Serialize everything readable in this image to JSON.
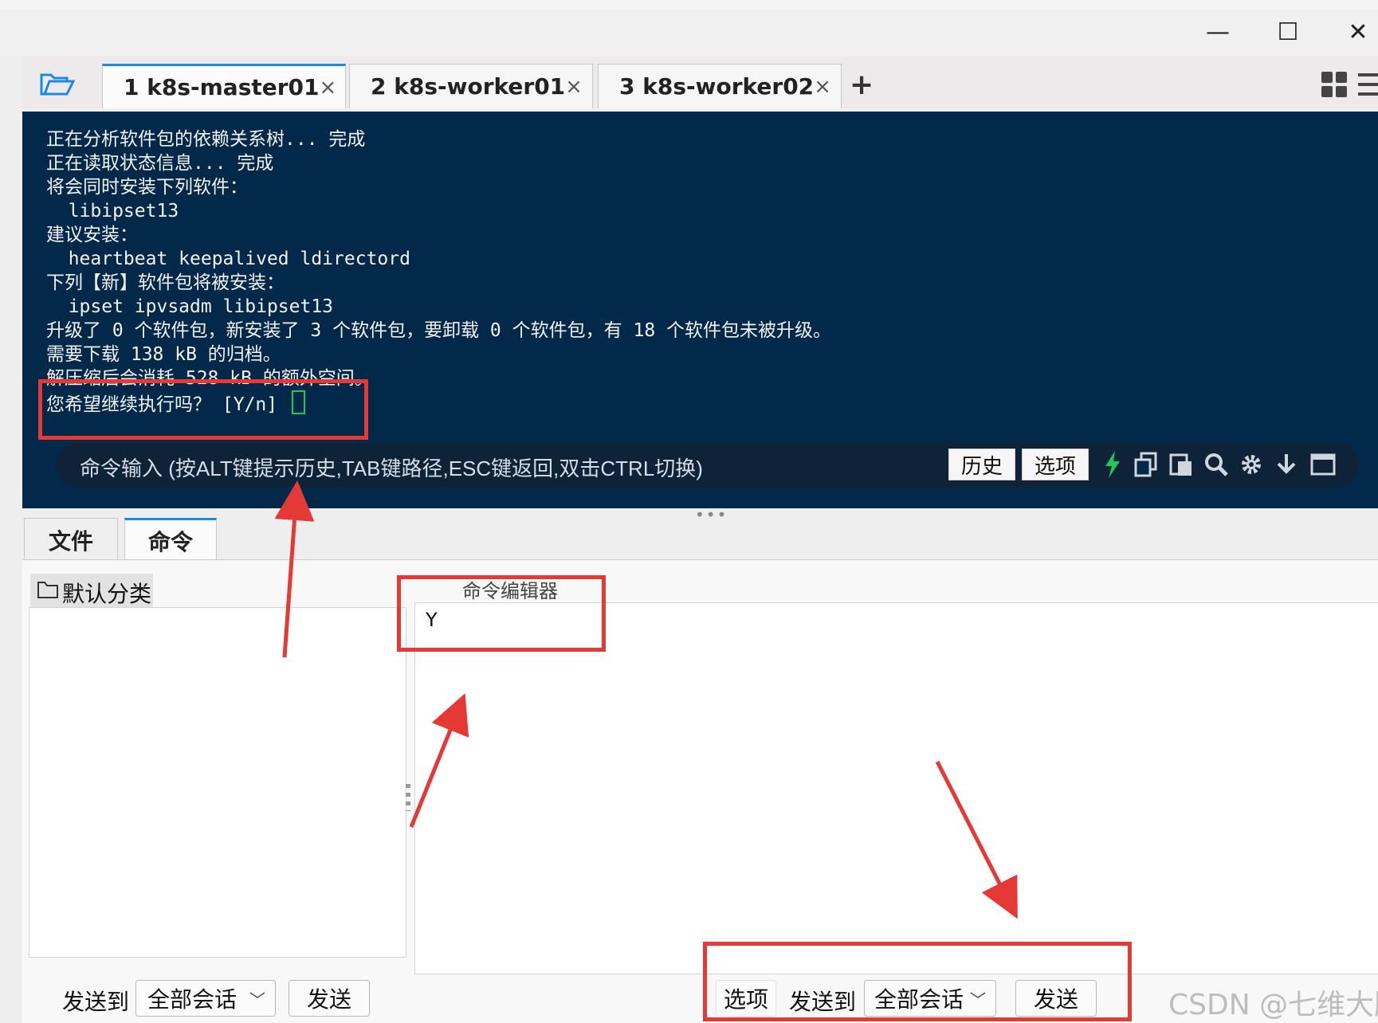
{
  "window": {
    "controls": {
      "minimize": "—",
      "maximize": "☐",
      "close": "✕"
    }
  },
  "tabs": [
    {
      "label": "1 k8s-master01",
      "close": "×",
      "status_color": "#22c55e",
      "active": true
    },
    {
      "label": "2 k8s-worker01",
      "close": "×",
      "status_color": "#22c55e",
      "active": false
    },
    {
      "label": "3 k8s-worker02",
      "close": "×",
      "status_color": "#22c55e",
      "active": false
    }
  ],
  "add_tab": "+",
  "terminal": {
    "background": "#02294a",
    "lines": [
      "正在分析软件包的依赖关系树... 完成",
      "正在读取状态信息... 完成",
      "将会同时安装下列软件：",
      "  libipset13",
      "建议安装：",
      "  heartbeat keepalived ldirectord",
      "下列【新】软件包将被安装：",
      "  ipset ipvsadm libipset13",
      "升级了 0 个软件包，新安装了 3 个软件包，要卸载 0 个软件包，有 18 个软件包未被升级。",
      "需要下载 138 kB 的归档。",
      "解压缩后会消耗 528 kB 的额外空间。"
    ],
    "prompt": "您希望继续执行吗？ [Y/n] "
  },
  "command_bar": {
    "hint": "命令输入 (按ALT键提示历史,TAB键路径,ESC键返回,双击CTRL切换)",
    "history_button": "历史",
    "options_button": "选项",
    "icons": [
      "lightning-icon",
      "copy-icon",
      "paste-icon",
      "search-icon",
      "gear-icon",
      "download-icon",
      "window-icon"
    ]
  },
  "bottom_tabs": [
    {
      "label": "文件",
      "active": false
    },
    {
      "label": "命令",
      "active": true
    }
  ],
  "command_panel": {
    "category": "默认分类",
    "editor_title": "命令编辑器",
    "editor_value": "Y"
  },
  "left_send": {
    "send_to_label": "发送到",
    "target": "全部会话",
    "send_button": "发送"
  },
  "right_send": {
    "options_button": "选项",
    "send_to_label": "发送到",
    "target": "全部会话",
    "send_button": "发送"
  },
  "annotation_color": "#e53935",
  "watermark": "CSDN @七维大脑"
}
